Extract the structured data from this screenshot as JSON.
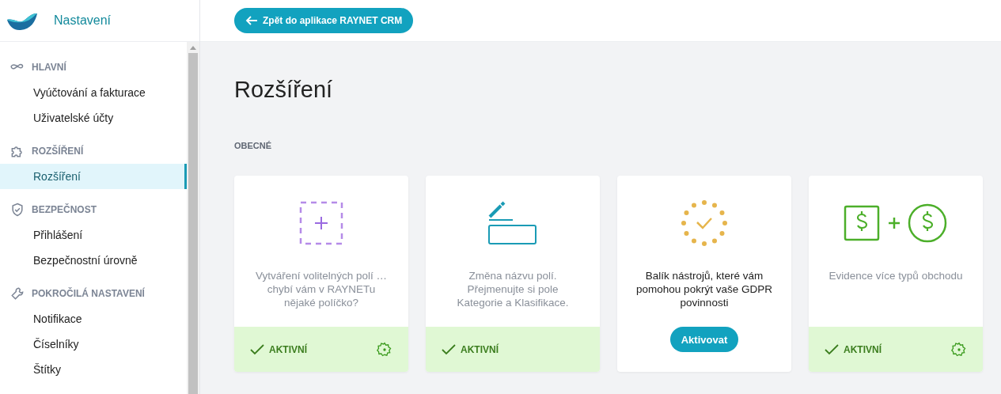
{
  "app": {
    "title": "Nastavení"
  },
  "back_button": {
    "label": "Zpět do aplikace RAYNET CRM"
  },
  "sidebar": {
    "sections": [
      {
        "kind": "main",
        "title": "HLAVNÍ",
        "items": [
          {
            "label": "Vyúčtování a fakturace",
            "selected": false
          },
          {
            "label": "Uživatelské účty",
            "selected": false
          }
        ]
      },
      {
        "kind": "extensions",
        "title": "ROZŠÍŘENÍ",
        "items": [
          {
            "label": "Rozšíření",
            "selected": true
          }
        ]
      },
      {
        "kind": "security",
        "title": "BEZPEČNOST",
        "items": [
          {
            "label": "Přihlášení",
            "selected": false
          },
          {
            "label": "Bezpečnostní úrovně",
            "selected": false
          }
        ]
      },
      {
        "kind": "advanced",
        "title": "POKROČILÁ NASTAVENÍ",
        "items": [
          {
            "label": "Notifikace",
            "selected": false
          },
          {
            "label": "Číselníky",
            "selected": false
          },
          {
            "label": "Štítky",
            "selected": false
          }
        ]
      }
    ]
  },
  "page": {
    "title": "Rozšíření",
    "section": "OBECNÉ"
  },
  "cards": [
    {
      "kind": "fields",
      "description": "Vytváření volitelných polí … chybí vám v RAYNETu nějaké políčko?",
      "active": true,
      "status_label": "AKTIVNÍ",
      "settings": true
    },
    {
      "kind": "rename",
      "description": "Změna názvu polí. Přejmenujte si pole Kategorie a Klasifikace.",
      "active": true,
      "status_label": "AKTIVNÍ",
      "settings": false
    },
    {
      "kind": "gdpr",
      "description": "Balík nástrojů, které vám pomohou pokrýt vaše GDPR povinnosti",
      "active": false,
      "action": "Aktivovat"
    },
    {
      "kind": "deals",
      "description": "Evidence více typů obchodu",
      "active": true,
      "status_label": "AKTIVNÍ",
      "settings": true
    }
  ]
}
